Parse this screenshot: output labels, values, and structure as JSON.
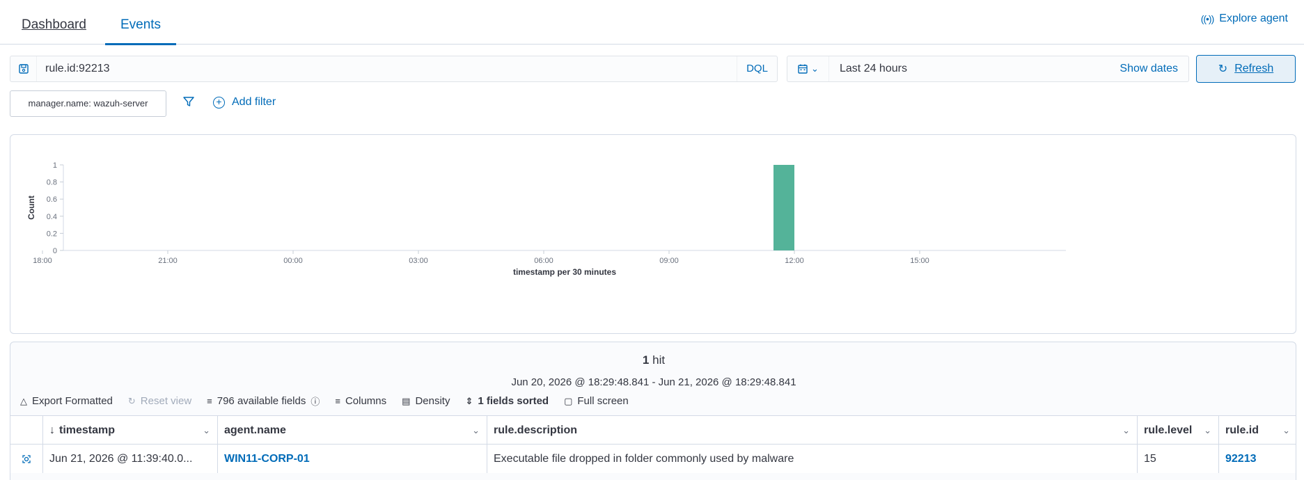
{
  "nav": {
    "tabs": [
      "Dashboard",
      "Events"
    ],
    "active_tab": "Events",
    "explore_agent": "Explore agent"
  },
  "query": {
    "value": "rule.id:92213",
    "language": "DQL"
  },
  "date": {
    "range": "Last 24 hours",
    "show_dates": "Show dates",
    "refresh": "Refresh"
  },
  "filters": {
    "pill": "manager.name: wazuh-server",
    "add_filter": "Add filter"
  },
  "chart_data": {
    "type": "bar",
    "ylabel": "Count",
    "xlabel": "timestamp per 30 minutes",
    "ylim": [
      0,
      1
    ],
    "y_ticks": [
      "0",
      "0.2",
      "0.4",
      "0.6",
      "0.8",
      "1"
    ],
    "x_ticks": [
      "21:00",
      "00:00",
      "03:00",
      "06:00",
      "09:00",
      "12:00",
      "15:00",
      "18:00"
    ],
    "x_range_hours": [
      18.5,
      42.5
    ],
    "bars": [
      {
        "x": "11:30",
        "x_hours": 35.5,
        "value": 1
      }
    ],
    "bar_color": "#54b399",
    "grid": false
  },
  "results": {
    "hit_count": "1",
    "hit_label": " hit",
    "range": "Jun 20, 2026 @ 18:29:48.841 - Jun 21, 2026 @ 18:29:48.841",
    "toolbar": {
      "export": "Export Formatted",
      "reset": "Reset view",
      "fields": "796 available fields",
      "columns": "Columns",
      "density": "Density",
      "sorted": "1 fields sorted",
      "fullscreen": "Full screen"
    },
    "columns": [
      "timestamp",
      "agent.name",
      "rule.description",
      "rule.level",
      "rule.id"
    ],
    "rows": [
      {
        "timestamp": "Jun 21, 2026 @ 11:39:40.0...",
        "agent_name": "WIN11-CORP-01",
        "rule_description": "Executable file dropped in folder commonly used by malware",
        "rule_level": "15",
        "rule_id": "92213"
      }
    ]
  }
}
